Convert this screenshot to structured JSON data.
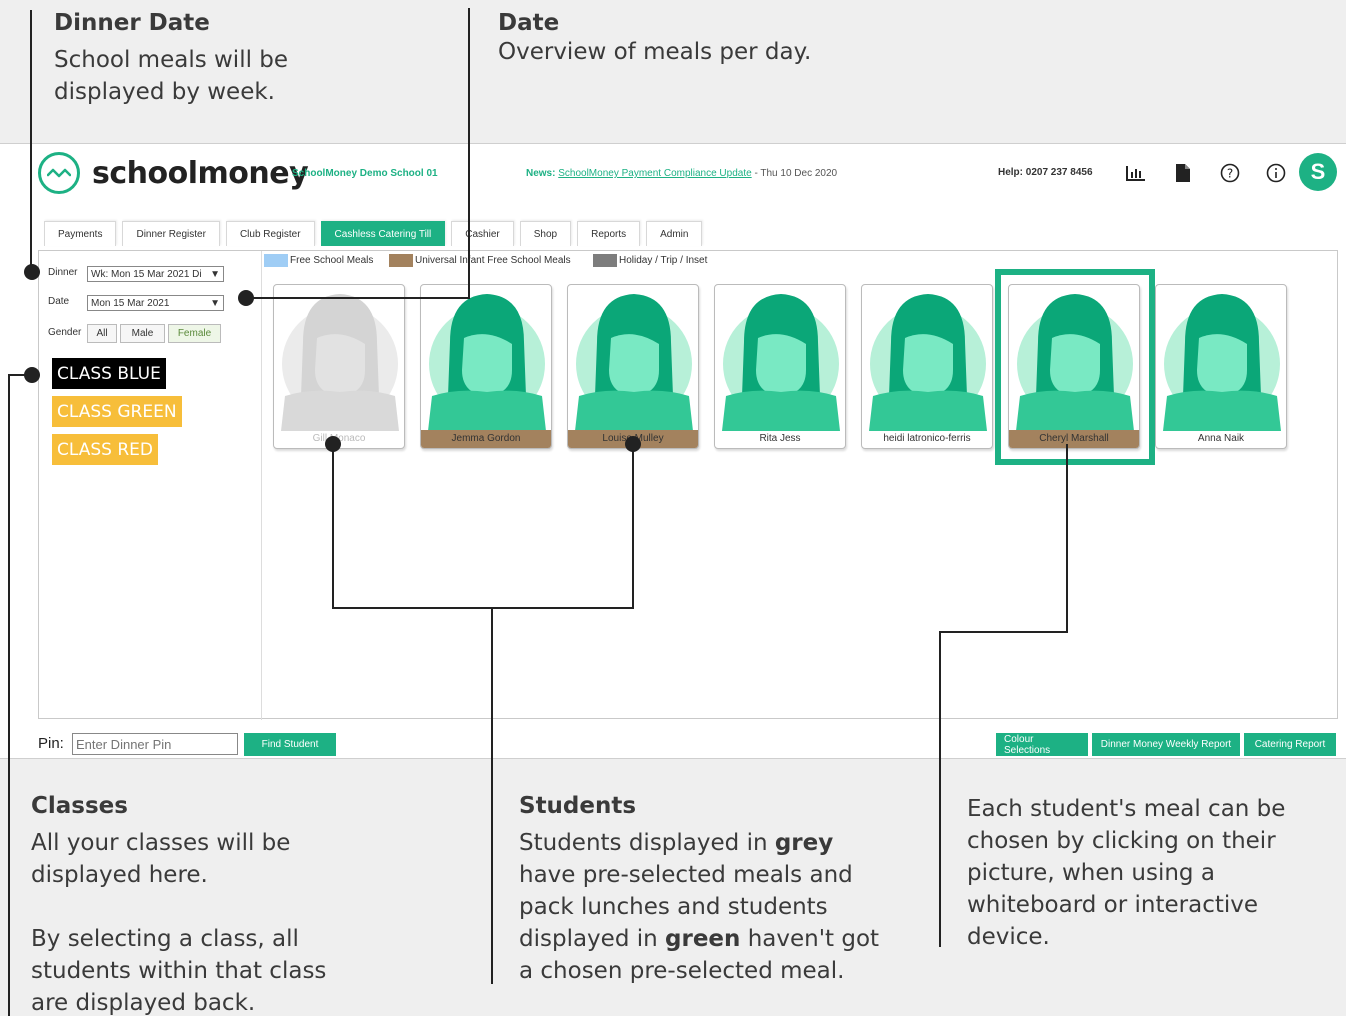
{
  "annotations": {
    "dinner_date": {
      "title": "Dinner Date",
      "text": "School meals will be displayed by week."
    },
    "date": {
      "title": "Date",
      "text": "Overview of meals per day."
    },
    "classes": {
      "title": "Classes",
      "text1": "All your classes will be displayed here.",
      "text2": "By selecting a class, all students within that class are displayed back."
    },
    "students": {
      "title": "Students",
      "t1": "Students displayed in ",
      "b1": "grey",
      "t2": " have pre-selected meals and pack lunches and students displayed in ",
      "b2": "green",
      "t3": " haven't got a chosen pre-selected meal."
    },
    "choose": {
      "text": "Each student's meal can be chosen by clicking on their picture, when using a whiteboard or interactive device."
    }
  },
  "header": {
    "logo_text": "schoolmoney",
    "school_name": "SchoolMoney Demo School 01",
    "news_label": "News:",
    "news_link": "SchoolMoney Payment Compliance Update",
    "news_date": " - Thu 10 Dec 2020",
    "help": "Help: 0207 237 8456",
    "avatar_initial": "S",
    "icons": [
      "bar-chart-icon",
      "document-icon",
      "help-circle-icon",
      "info-circle-icon"
    ]
  },
  "tabs": [
    {
      "label": "Payments"
    },
    {
      "label": "Dinner Register"
    },
    {
      "label": "Club Register"
    },
    {
      "label": "Cashless Catering Till",
      "active": true
    },
    {
      "label": "Cashier"
    },
    {
      "label": "Shop"
    },
    {
      "label": "Reports"
    },
    {
      "label": "Admin"
    }
  ],
  "filters": {
    "dinner_label": "Dinner",
    "dinner_value": "Wk: Mon 15 Mar 2021 Di",
    "date_label": "Date",
    "date_value": "Mon 15 Mar 2021",
    "gender_label": "Gender",
    "gender_options": [
      "All",
      "Male",
      "Female"
    ],
    "gender_selected": "Female"
  },
  "classes": [
    {
      "label": "CLASS BLUE",
      "color": "#000000"
    },
    {
      "label": "CLASS GREEN",
      "color": "#f7be3a"
    },
    {
      "label": "CLASS RED",
      "color": "#f7be3a"
    }
  ],
  "legend": [
    {
      "label": "Free School Meals",
      "color": "#9fcdf5"
    },
    {
      "label": "Universal Infant Free School Meals",
      "color": "#a3825e"
    },
    {
      "label": "Holiday / Trip / Inset",
      "color": "#7d7d7d"
    }
  ],
  "students": [
    {
      "name": "Gill Monaco",
      "status": "pre-selected"
    },
    {
      "name": "Jemma Gordon",
      "status": "uifsm"
    },
    {
      "name": "Louise Mulley",
      "status": "uifsm"
    },
    {
      "name": "Rita Jess",
      "status": "none"
    },
    {
      "name": "heidi latronico-ferris",
      "status": "none"
    },
    {
      "name": "Cheryl Marshall",
      "status": "uifsm",
      "selected": true
    },
    {
      "name": "Anna Naik",
      "status": "none"
    }
  ],
  "footer": {
    "pin_label": "Pin:",
    "pin_placeholder": "Enter Dinner Pin",
    "find_button": "Find Student",
    "colour_button": "Colour Selections",
    "weekly_report_button": "Dinner Money Weekly Report",
    "catering_report_button": "Catering Report"
  }
}
